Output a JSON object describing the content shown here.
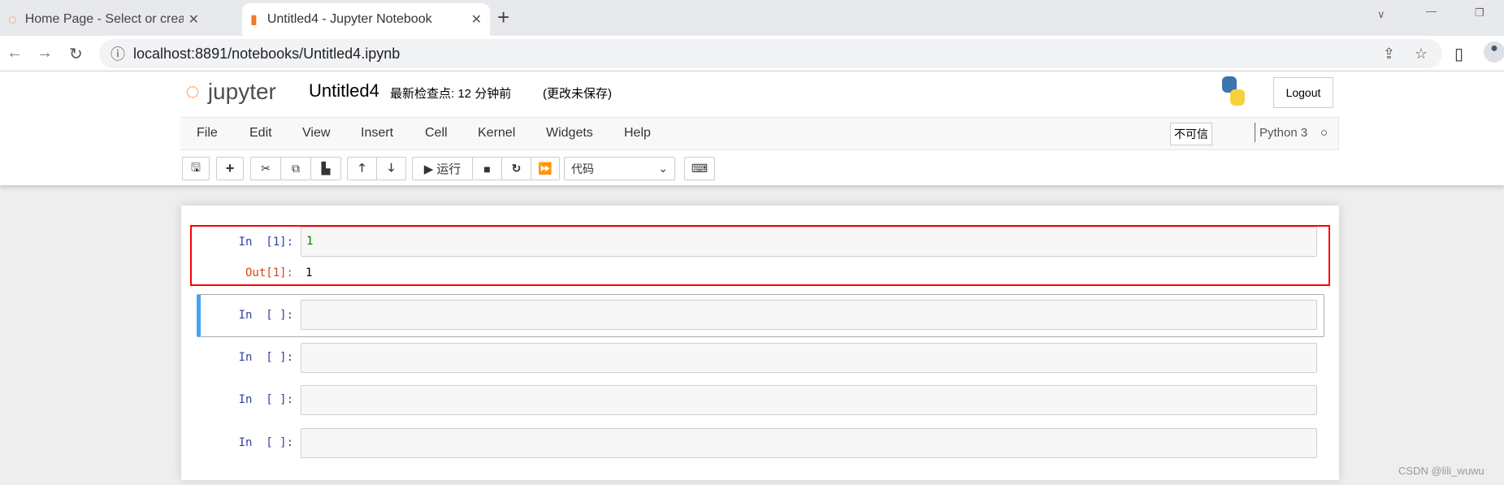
{
  "browser": {
    "tabs": [
      {
        "title": "Home Page - Select or create a",
        "icon": "jupyter-icon",
        "active": false
      },
      {
        "title": "Untitled4 - Jupyter Notebook",
        "icon": "notebook-icon",
        "active": true
      }
    ],
    "url": "localhost:8891/notebooks/Untitled4.ipynb"
  },
  "header": {
    "logo_text": "jupyter",
    "notebook_name": "Untitled4",
    "checkpoint": "最新检查点: 12 分钟前",
    "unsaved": "(更改未保存)",
    "logout": "Logout"
  },
  "menu": {
    "items": [
      "File",
      "Edit",
      "View",
      "Insert",
      "Cell",
      "Kernel",
      "Widgets",
      "Help"
    ],
    "trust": "不可信",
    "kernel": "Python 3"
  },
  "toolbar": {
    "run_label": "运行",
    "cell_type": "代码"
  },
  "cells": [
    {
      "prompt": "In  [1]:",
      "code": "1",
      "out_prompt": "Out[1]:",
      "output": "1"
    },
    {
      "prompt": "In  [ ]:",
      "code": ""
    },
    {
      "prompt": "In  [ ]:",
      "code": ""
    },
    {
      "prompt": "In  [ ]:",
      "code": ""
    },
    {
      "prompt": "In  [ ]:",
      "code": ""
    }
  ],
  "watermark": "CSDN @lili_wuwu",
  "colors": {
    "highlight": "#ff0000",
    "selected": "#42a5f5",
    "out_prompt": "#d84315",
    "brand": "#f37726"
  }
}
